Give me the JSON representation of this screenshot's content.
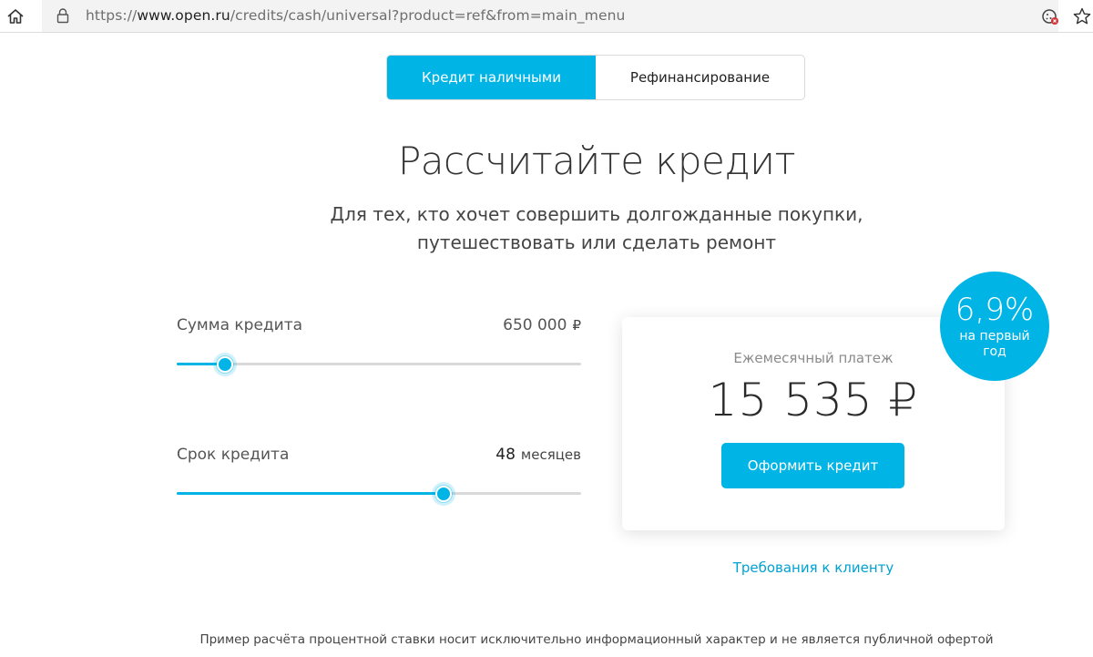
{
  "browser": {
    "url_prefix": "https://",
    "url_host": "www.open.ru",
    "url_path": "/credits/cash/universal?product=ref&from=main_menu"
  },
  "tabs": [
    {
      "label": "Кредит наличными",
      "active": true
    },
    {
      "label": "Рефинансирование",
      "active": false
    }
  ],
  "heading": {
    "title": "Рассчитайте кредит",
    "subtitle_line1": "Для тех, кто хочет совершить долгожданные покупки,",
    "subtitle_line2": "путешествовать или сделать ремонт"
  },
  "sliders": {
    "amount": {
      "label": "Сумма кредита",
      "value": "650 000",
      "unit": "₽",
      "level": 0.12
    },
    "term": {
      "label": "Срок кредита",
      "value": "48",
      "unit": "месяцев",
      "level": 0.66
    }
  },
  "result": {
    "label": "Ежемесячный платеж",
    "value": "15 535 ₽",
    "apply_button": "Оформить кредит"
  },
  "rate_badge": {
    "value": "6,9%",
    "note": "на первый год"
  },
  "links": {
    "requirements": "Требования к клиенту"
  },
  "footer": {
    "disclaimer": "Пример расчёта процентной ставки носит исключительно информационный характер и не является публичной офертой"
  },
  "colors": {
    "accent": "#00b4e6",
    "link": "#00a2d1",
    "track": "#d9d9d9"
  }
}
